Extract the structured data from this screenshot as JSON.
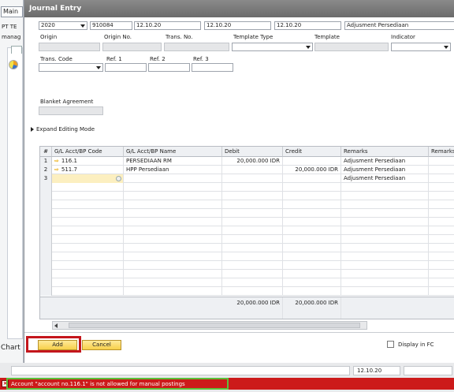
{
  "background": {
    "main_tab": "Main",
    "company": "PT TE",
    "manager": "manag",
    "chart_label": "Chart"
  },
  "window": {
    "title": "Journal Entry"
  },
  "header": {
    "year": "2020",
    "doc_number": "910084",
    "posting_date": "12.10.20",
    "due_date": "12.10.20",
    "doc_date": "12.10.20",
    "remarks": "Adjusment Persediaan"
  },
  "labels": {
    "origin": "Origin",
    "origin_no": "Origin No.",
    "trans_no": "Trans. No.",
    "template_type": "Template Type",
    "template": "Template",
    "indicator": "Indicator",
    "trans_code": "Trans. Code",
    "ref1": "Ref. 1",
    "ref2": "Ref. 2",
    "ref3": "Ref. 3",
    "blanket_agreement": "Blanket Agreement",
    "expand_editing": "Expand Editing Mode"
  },
  "grid": {
    "columns": [
      "#",
      "G/L Acct/BP Code",
      "G/L Acct/BP Name",
      "Debit",
      "Credit",
      "Remarks",
      "Remarks"
    ],
    "rows": [
      {
        "num": "1",
        "code": "116.1",
        "name": "PERSEDIAAN RM",
        "debit": "20,000.000 IDR",
        "credit": "",
        "remarks": "Adjusment Persediaan"
      },
      {
        "num": "2",
        "code": "511.7",
        "name": "HPP Persediaan",
        "debit": "",
        "credit": "20,000.000 IDR",
        "remarks": "Adjusment Persediaan"
      },
      {
        "num": "3",
        "code": "",
        "name": "",
        "debit": "",
        "credit": "",
        "remarks": "Adjusment Persediaan"
      }
    ],
    "total_debit": "20,000.000 IDR",
    "total_credit": "20,000.000 IDR"
  },
  "buttons": {
    "add": "Add",
    "cancel": "Cancel",
    "display_fc": "Display in FC"
  },
  "status": {
    "date": "12.10.20",
    "error": "Account \"account no.116.1\" is not allowed for manual postings",
    "error_color": "#cc1a1a",
    "highlight_red": "#c4161c",
    "highlight_green": "#5cbf3a"
  }
}
